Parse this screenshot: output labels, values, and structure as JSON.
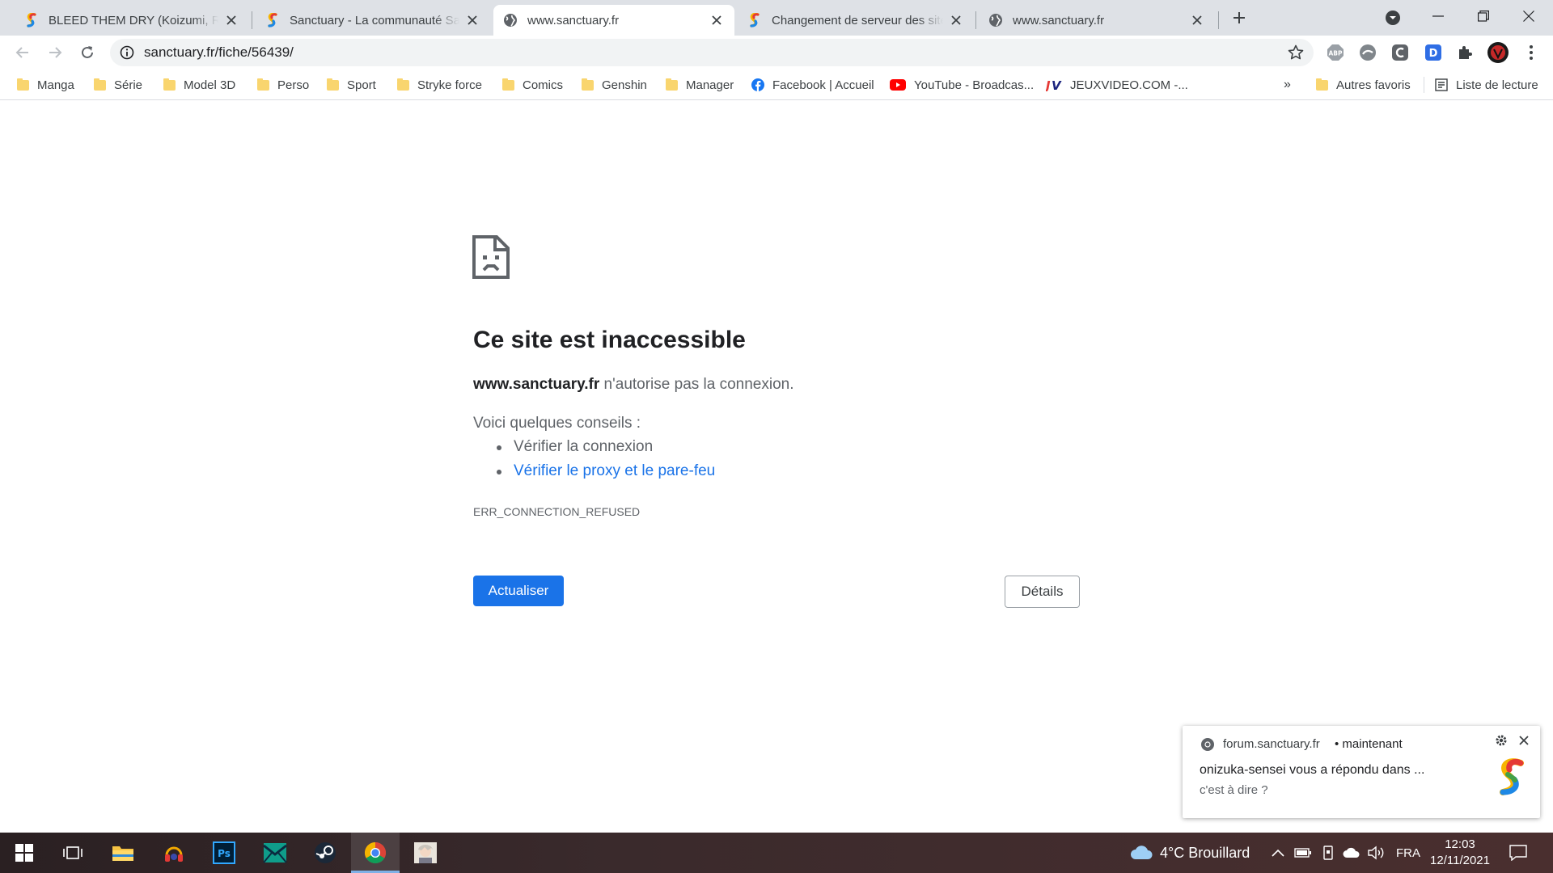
{
  "browser": {
    "tabs": [
      {
        "title": "BLEED THEM DRY (Koizumi, Rahal",
        "favicon": "sanctuary-logo",
        "active": false
      },
      {
        "title": "Sanctuary - La communauté Sanctuary",
        "favicon": "sanctuary-logo",
        "active": false
      },
      {
        "title": "www.sanctuary.fr",
        "favicon": "globe-icon",
        "active": true
      },
      {
        "title": "Changement de serveur des sites",
        "favicon": "sanctuary-logo",
        "active": false
      },
      {
        "title": "www.sanctuary.fr",
        "favicon": "globe-icon",
        "active": false
      }
    ],
    "address": {
      "url": "sanctuary.fr/fiche/56439/"
    },
    "extensions": [
      "adblock-icon",
      "extension-grey-icon",
      "extension-c-icon",
      "d-extension-icon",
      "puzzle-icon",
      "profile-avatar"
    ],
    "bookmarks": [
      {
        "label": "Manga",
        "icon": "folder-icon"
      },
      {
        "label": "Série",
        "icon": "folder-icon"
      },
      {
        "label": "Model 3D",
        "icon": "folder-icon"
      },
      {
        "label": "Perso",
        "icon": "folder-icon"
      },
      {
        "label": "Sport",
        "icon": "folder-icon"
      },
      {
        "label": "Stryke force",
        "icon": "folder-icon"
      },
      {
        "label": "Comics",
        "icon": "folder-icon"
      },
      {
        "label": "Genshin",
        "icon": "folder-icon"
      },
      {
        "label": "Manager",
        "icon": "folder-icon"
      },
      {
        "label": "Facebook | Accueil",
        "icon": "facebook-icon"
      },
      {
        "label": "YouTube - Broadcas...",
        "icon": "youtube-icon"
      },
      {
        "label": "JEUXVIDEO.COM -...",
        "icon": "jv-icon"
      }
    ],
    "bookmarks_overflow": "»",
    "other_bookmarks": "Autres favoris",
    "reading_list": "Liste de lecture"
  },
  "error_page": {
    "title": "Ce site est inaccessible",
    "host": "www.sanctuary.fr",
    "message": " n'autorise pas la connexion.",
    "tips_heading": "Voici quelques conseils :",
    "tips": [
      "Vérifier la connexion",
      "Vérifier le proxy et le pare-feu"
    ],
    "code": "ERR_CONNECTION_REFUSED",
    "reload_label": "Actualiser",
    "details_label": "Détails",
    "accent_color": "#1a73e8"
  },
  "notification": {
    "source": "forum.sanctuary.fr",
    "time": "maintenant",
    "title": "onizuka-sensei vous a répondu dans ...",
    "body": "c'est à dire ?"
  },
  "taskbar": {
    "apps": [
      "start-icon",
      "task-view-icon",
      "file-explorer-icon",
      "headset-app-icon",
      "photoshop-icon",
      "mail-app-icon",
      "steam-icon",
      "chrome-icon",
      "character-app-icon"
    ],
    "weather": "4°C  Brouillard",
    "language": "FRA",
    "time": "12:03",
    "date": "12/11/2021"
  }
}
